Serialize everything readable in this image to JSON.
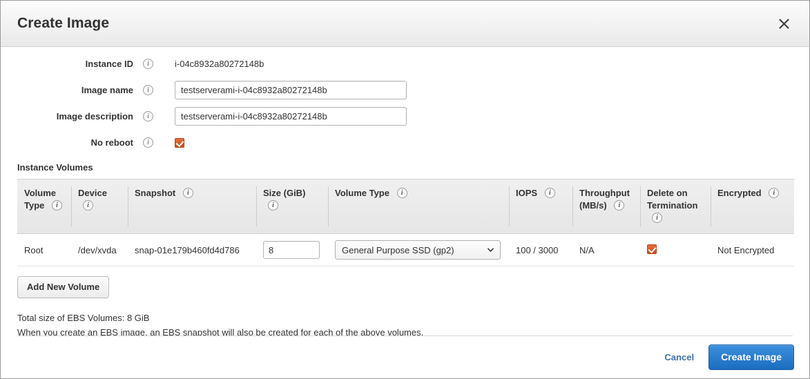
{
  "dialog": {
    "title": "Create Image",
    "close_icon": "close-icon"
  },
  "form": {
    "instance_id": {
      "label": "Instance ID",
      "value": "i-04c8932a80272148b"
    },
    "image_name": {
      "label": "Image name",
      "value": "testserverami-i-04c8932a80272148b",
      "placeholder": ""
    },
    "image_description": {
      "label": "Image description",
      "value": "testserverami-i-04c8932a80272148b",
      "placeholder": ""
    },
    "no_reboot": {
      "label": "No reboot",
      "checked": true
    }
  },
  "volumes_section": {
    "title": "Instance Volumes",
    "columns": [
      "Volume Type",
      "Device",
      "Snapshot",
      "Size (GiB)",
      "Volume Type",
      "IOPS",
      "Throughput (MB/s)",
      "Delete on Termination",
      "Encrypted"
    ],
    "rows": [
      {
        "volume_type_kind": "Root",
        "device": "/dev/xvda",
        "snapshot": "snap-01e179b460fd4d786",
        "size": "8",
        "volume_type": "General Purpose SSD (gp2)",
        "iops": "100 / 3000",
        "throughput": "N/A",
        "delete_on_termination": true,
        "encrypted": "Not Encrypted"
      }
    ],
    "add_volume_label": "Add New Volume"
  },
  "notes": {
    "total_size": "Total size of EBS Volumes: 8 GiB",
    "snapshot_note": "When you create an EBS image, an EBS snapshot will also be created for each of the above volumes."
  },
  "footer": {
    "cancel_label": "Cancel",
    "create_label": "Create Image"
  },
  "colors": {
    "accent_blue": "#1b6dc0",
    "link_blue": "#3e6fa8",
    "checkbox_orange": "#cf4d1c",
    "header_bg": "#f2f2f2",
    "table_header_bg": "#e9e9e9"
  }
}
